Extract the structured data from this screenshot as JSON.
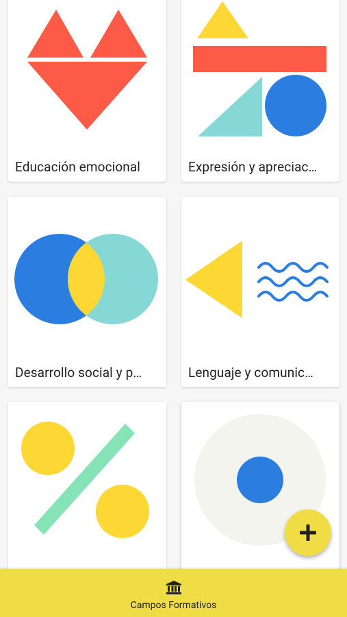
{
  "cards": [
    {
      "label": "Educación emocional",
      "illustration": "heart-triangles"
    },
    {
      "label": "Expresión y apreciac…",
      "illustration": "shapes-composition"
    },
    {
      "label": "Desarrollo social y p…",
      "illustration": "venn-circles"
    },
    {
      "label": "Lenguaje y comunic…",
      "illustration": "triangle-and-waves"
    },
    {
      "label": "",
      "illustration": "percent-sign"
    },
    {
      "label": "",
      "illustration": "target-circle"
    }
  ],
  "fab": {
    "icon": "plus-icon"
  },
  "bottom_nav": {
    "items": [
      {
        "label": "Campos Formativos",
        "icon": "institution-icon"
      }
    ]
  },
  "colors": {
    "red": "#fd5b48",
    "yellow": "#fdd835",
    "blue": "#2b7de0",
    "teal": "#86d8d6",
    "green": "#86e3b5",
    "light_gray": "#f4f4ef",
    "accent": "#f0dd46"
  }
}
